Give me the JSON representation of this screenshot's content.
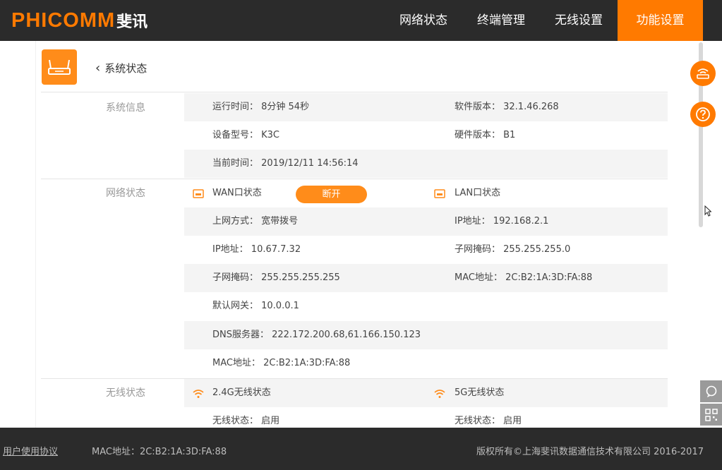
{
  "brand": {
    "logo_en": "PHICOMM",
    "logo_cn": "斐讯",
    "accent_color": "#ff7a00",
    "header_bg": "#2b2b2b"
  },
  "nav": {
    "items": [
      {
        "label": "网络状态"
      },
      {
        "label": "终端管理"
      },
      {
        "label": "无线设置"
      },
      {
        "label": "功能设置",
        "active": true
      }
    ]
  },
  "page": {
    "icon": "router-icon",
    "back_label": "系统状态"
  },
  "system_info": {
    "title": "系统信息",
    "uptime": "运行时间： 8分钟 54秒",
    "software_version": "软件版本： 32.1.46.268",
    "device_model": "设备型号： K3C",
    "hardware_version": "硬件版本： B1",
    "current_time": "当前时间： 2019/12/11 14:56:14"
  },
  "network_status": {
    "title": "网络状态",
    "wan": {
      "header": "WAN口状态",
      "button": "断开",
      "connection_type": "上网方式： 宽带拨号",
      "ip": "IP地址： 10.67.7.32",
      "subnet": "子网掩码： 255.255.255.255",
      "gateway": "默认网关： 10.0.0.1",
      "dns": "DNS服务器： 222.172.200.68,61.166.150.123",
      "mac": "MAC地址： 2C:B2:1A:3D:FA:88"
    },
    "lan": {
      "header": "LAN口状态",
      "ip": "IP地址： 192.168.2.1",
      "subnet": "子网掩码： 255.255.255.0",
      "mac": "MAC地址： 2C:B2:1A:3D:FA:88"
    }
  },
  "wireless_status": {
    "title": "无线状态",
    "band_24": {
      "header": "2.4G无线状态",
      "status": "无线状态： 启用"
    },
    "band_5": {
      "header": "5G无线状态",
      "status": "无线状态： 启用"
    }
  },
  "footer": {
    "agreement": "用户使用协议",
    "mac": "MAC地址：2C:B2:1A:3D:FA:88",
    "copyright": "版权所有©上海斐讯数据通信技术有限公司 2016-2017"
  },
  "side_icons": [
    "router-status-icon",
    "help-icon",
    "feedback-icon",
    "qr-code-icon"
  ]
}
